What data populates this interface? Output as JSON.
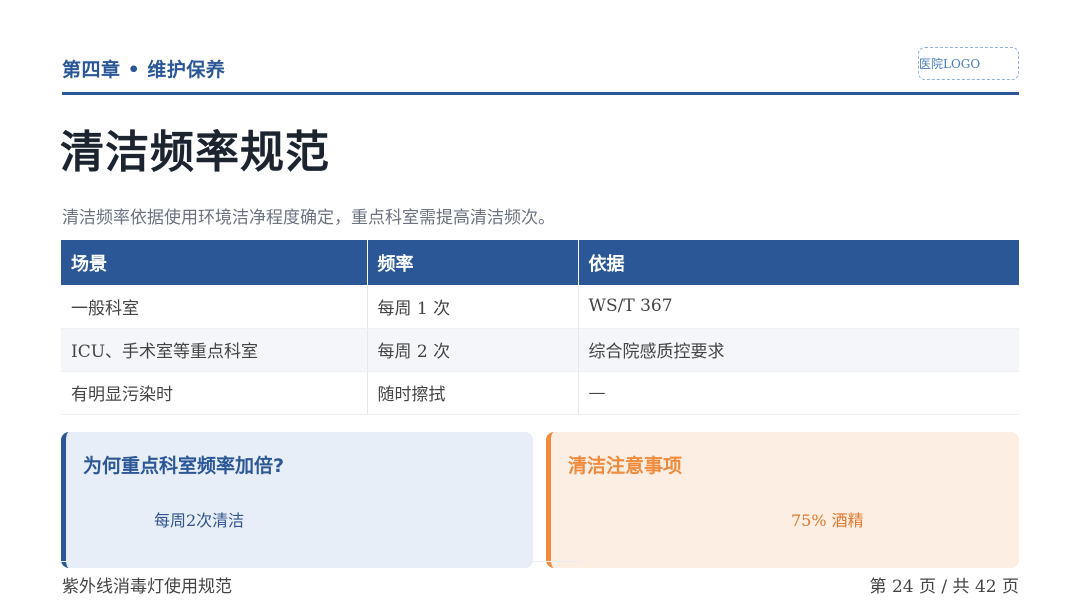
{
  "header": {
    "chapter": "第四章 • 维护保养",
    "logo": "医院LOGO"
  },
  "page": {
    "title": "清洁频率规范",
    "subtitle": "清洁频率依据使用环境洁净程度确定，重点科室需提高清洁频次。"
  },
  "table": {
    "headers": [
      "场景",
      "频率",
      "依据"
    ],
    "rows": [
      [
        "一般科室",
        "每周 1 次",
        "WS/T 367"
      ],
      [
        "ICU、手术室等重点科室",
        "每周 2 次",
        "综合院感质控要求"
      ],
      [
        "有明显污染时",
        "随时擦拭",
        "—"
      ]
    ]
  },
  "cards": {
    "left": {
      "title": "为何重点科室频率加倍?",
      "body": "每周2次清洁"
    },
    "right": {
      "title": "清洁注意事项",
      "body": "75% 酒精"
    }
  },
  "footer": {
    "doc_title": "紫外线消毒灯使用规范",
    "page_prefix": "第",
    "page_current": "24",
    "page_mid": "页 / 共",
    "page_total": "42",
    "page_suffix": "页"
  },
  "colors": {
    "primary": "#2b5797",
    "accent": "#f08a3c"
  }
}
